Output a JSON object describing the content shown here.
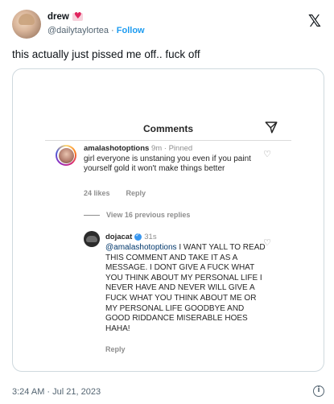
{
  "tweet": {
    "display_name": "drew",
    "handle": "@dailytaylortea",
    "separator": "·",
    "follow_label": "Follow",
    "text": "this actually just pissed me off.. fuck off",
    "timestamp": "3:24 AM · Jul 21, 2023"
  },
  "icons": {
    "platform_logo": "x-logo-icon",
    "verified_badge": "heart-badge-icon",
    "send": "send-icon",
    "like": "heart-icon",
    "info": "info-icon"
  },
  "instagram": {
    "header_title": "Comments",
    "comment1": {
      "username": "amalashotoptions",
      "age": "9m",
      "pinned_label": "· Pinned",
      "body": "girl everyone is unstaning you even if you paint yourself gold it won't make things better",
      "likes": "24 likes",
      "reply_label": "Reply"
    },
    "view_replies_label": "View 16 previous replies",
    "comment2": {
      "username": "dojacat",
      "age": "31s",
      "mention": "@amalashotoptions",
      "body": " I WANT YALL TO READ THIS COMMENT AND TAKE IT AS A MESSAGE. I DONT GIVE A FUCK WHAT YOU THINK ABOUT MY PERSONAL LIFE I NEVER HAVE AND NEVER WILL GIVE A FUCK WHAT YOU THINK ABOUT ME OR MY PERSONAL LIFE GOODBYE AND GOOD RIDDANCE MISERABLE HOES HAHA!",
      "reply_label": "Reply"
    }
  },
  "colors": {
    "link": "#1d9bf0",
    "mention": "#00376b",
    "muted": "#8e8e8e",
    "tweet_muted": "#536471"
  }
}
